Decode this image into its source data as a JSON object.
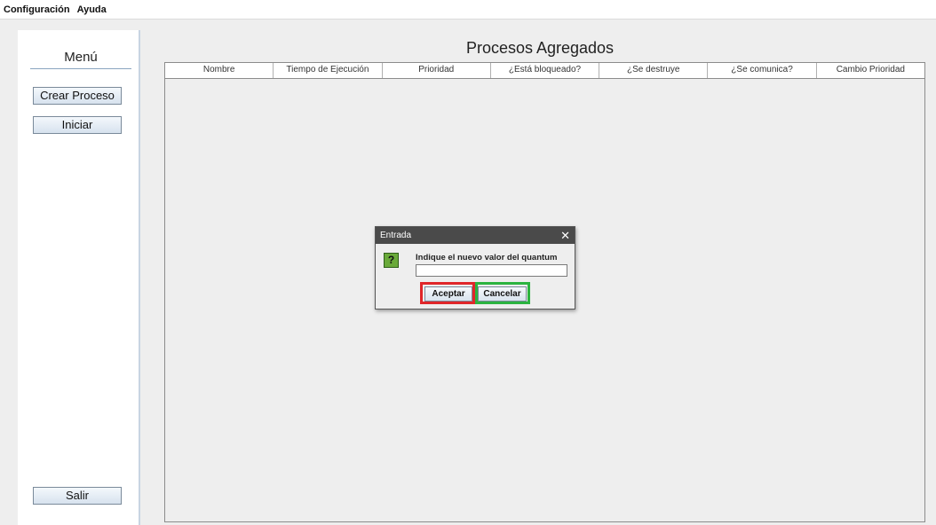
{
  "menubar": {
    "items": [
      "Configuración",
      "Ayuda"
    ]
  },
  "sidebar": {
    "title": "Menú",
    "buttons": {
      "create": "Crear Proceso",
      "start": "Iniciar",
      "exit": "Salir"
    }
  },
  "main": {
    "title": "Procesos Agregados",
    "columns": [
      "Nombre",
      "Tiempo de Ejecución",
      "Prioridad",
      "¿Está bloqueado?",
      "¿Se destruye",
      "¿Se comunica?",
      "Cambio Prioridad"
    ]
  },
  "dialog": {
    "title": "Entrada",
    "close": "✕",
    "icon": "question-icon",
    "icon_glyph": "?",
    "message": "Indique el nuevo valor del quantum",
    "input_value": "",
    "ok_label": "Aceptar",
    "cancel_label": "Cancelar"
  },
  "colors": {
    "ok_highlight": "#e0262a",
    "cancel_highlight": "#2bb340"
  }
}
